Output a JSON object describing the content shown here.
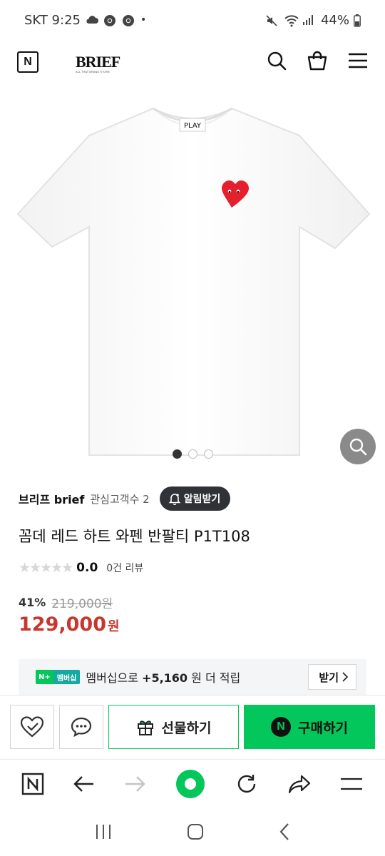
{
  "status_bar": {
    "carrier_time": "SKT 9:25",
    "battery": "44%",
    "icons": [
      "cloud-icon",
      "chrome-icon",
      "chrome-icon",
      "dot-icon",
      "mute-icon",
      "wifi-icon",
      "signal-icon",
      "battery-icon"
    ]
  },
  "header": {
    "logo_letter": "N",
    "brand": "BRIEF",
    "brand_tagline": "ALL THAT BRAND STORE",
    "icons": [
      "search-icon",
      "cart-icon",
      "menu-icon"
    ]
  },
  "product": {
    "image": "white-tshirt-red-heart",
    "label": "PLAY",
    "image_count": 3,
    "active_image": 0
  },
  "store": {
    "name": "브리프 brief",
    "fans": "관심고객수 2",
    "alarm_button": "알림받기"
  },
  "title": "꼼데 레드 하트 와펜 반팔티 P1T108",
  "rating": {
    "stars": "★★★★★",
    "score": "0.0",
    "reviews": "0건 리뷰"
  },
  "price": {
    "discount": "41%",
    "original": "219,000원",
    "sale": "129,000",
    "unit": "원"
  },
  "membership": {
    "badge_n": "N+",
    "badge_label": "멤버십",
    "text_prefix": "멤버십으로 ",
    "points": "+5,160",
    "text_suffix": " 원 더 적립",
    "receive_button": "받기"
  },
  "actions": {
    "gift_button": "선물하기",
    "buy_button": "구매하기",
    "buy_badge": "N"
  },
  "colors": {
    "naver_green": "#03c75a",
    "price_red": "#c8372d",
    "alarm_bg": "#2f3237"
  }
}
